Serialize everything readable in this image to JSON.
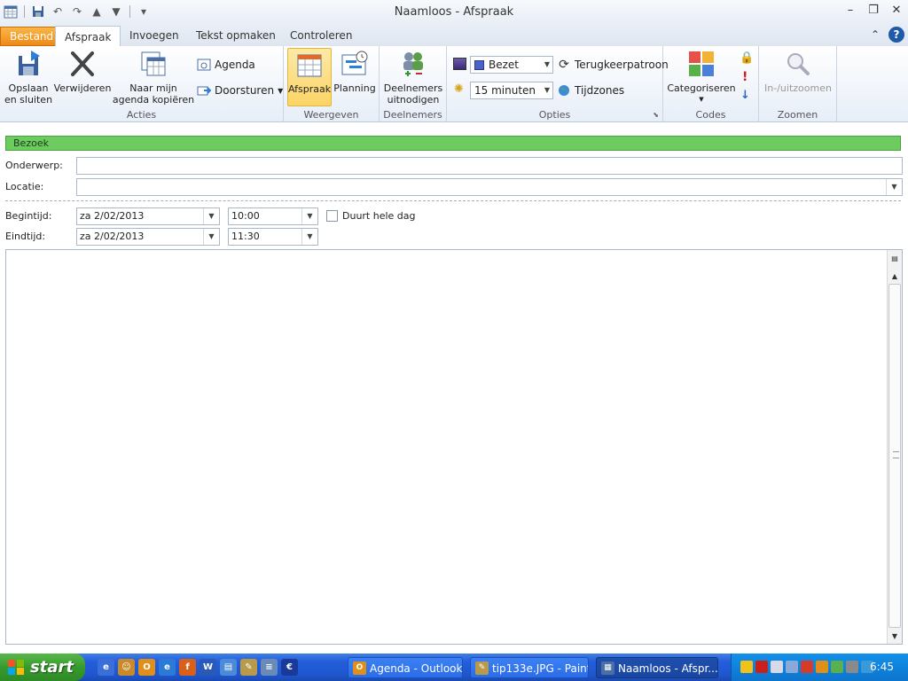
{
  "window": {
    "title": "Naamloos  -  Afspraak"
  },
  "ribbon_tabs": [
    {
      "label": "Bestand"
    },
    {
      "label": "Afspraak"
    },
    {
      "label": "Invoegen"
    },
    {
      "label": "Tekst opmaken"
    },
    {
      "label": "Controleren"
    }
  ],
  "ribbon": {
    "acties": {
      "label": "Acties",
      "save_close": "Opslaan\nen sluiten",
      "delete": "Verwijderen",
      "copy": "Naar mijn\nagenda kopiëren",
      "agenda": "Agenda",
      "forward": "Doorsturen"
    },
    "weergeven": {
      "label": "Weergeven",
      "appointment": "Afspraak",
      "planning": "Planning"
    },
    "deelnemers": {
      "label": "Deelnemers",
      "invite": "Deelnemers\nuitnodigen"
    },
    "opties": {
      "label": "Opties",
      "show_as": "Bezet",
      "reminder": "15 minuten",
      "recurrence": "Terugkeerpatroon",
      "timezones": "Tijdzones"
    },
    "codes": {
      "label": "Codes",
      "categorize": "Categoriseren"
    },
    "zoomen": {
      "label": "Zoomen",
      "zoom": "In-/uitzoomen"
    }
  },
  "form": {
    "banner": "Bezoek",
    "subject_label": "Onderwerp:",
    "subject_value": "",
    "location_label": "Locatie:",
    "location_value": "",
    "start_label": "Begintijd:",
    "start_date": "za 2/02/2013",
    "start_time": "10:00",
    "allday_label": "Duurt hele dag",
    "end_label": "Eindtijd:",
    "end_date": "za 2/02/2013",
    "end_time": "11:30"
  },
  "taskbar": {
    "start": "start",
    "tasks": [
      {
        "label": "Agenda - Outlook..."
      },
      {
        "label": "tip133e.JPG - Paint"
      },
      {
        "label": "Naamloos - Afspr..."
      }
    ],
    "clock": "6:45"
  },
  "colors": {
    "banner_green": "#6ccc5f",
    "file_tab_orange": "#ef8a16",
    "taskbar_blue": "#245edb",
    "selected_button": "#fbd467"
  }
}
